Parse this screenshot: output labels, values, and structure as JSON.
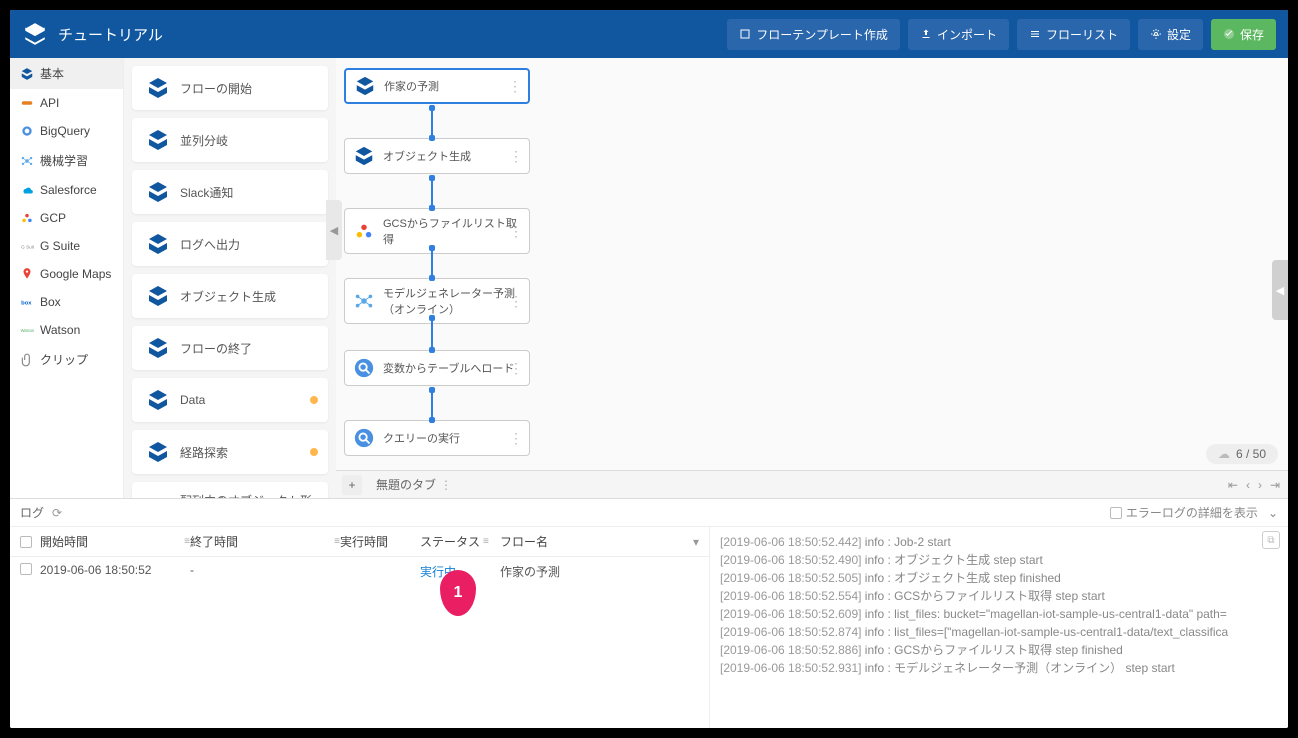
{
  "header": {
    "title": "チュートリアル",
    "buttons": {
      "template": "フローテンプレート作成",
      "import": "インポート",
      "list": "フローリスト",
      "settings": "設定",
      "save": "保存"
    }
  },
  "sidebar": {
    "items": [
      {
        "label": "基本",
        "icon": "cube",
        "color": "#1057a0"
      },
      {
        "label": "API",
        "icon": "api",
        "color": "#e67e22"
      },
      {
        "label": "BigQuery",
        "icon": "bq",
        "color": "#4a90e2"
      },
      {
        "label": "機械学習",
        "icon": "ml",
        "color": "#5aa8e8"
      },
      {
        "label": "Salesforce",
        "icon": "sf",
        "color": "#00a1e0"
      },
      {
        "label": "GCP",
        "icon": "gcp",
        "color": "#ea4335"
      },
      {
        "label": "G Suite",
        "icon": "gsuite",
        "color": "#888"
      },
      {
        "label": "Google Maps",
        "icon": "maps",
        "color": "#ea4335"
      },
      {
        "label": "Box",
        "icon": "box",
        "color": "#0061d5"
      },
      {
        "label": "Watson",
        "icon": "watson",
        "color": "#5aaf6e"
      },
      {
        "label": "クリップ",
        "icon": "clip",
        "color": "#888"
      }
    ]
  },
  "palette": {
    "items": [
      {
        "label": "フローの開始"
      },
      {
        "label": "並列分岐"
      },
      {
        "label": "Slack通知"
      },
      {
        "label": "ログへ出力"
      },
      {
        "label": "オブジェクト生成"
      },
      {
        "label": "フローの終了"
      },
      {
        "label": "Data",
        "dot": "#ffb74d"
      },
      {
        "label": "経路探索",
        "dot": "#ffb74d"
      },
      {
        "label": "配列内のオブジェクト形式",
        "dot": "#81d4fa"
      }
    ]
  },
  "canvas": {
    "nodes": [
      {
        "label": "作家の予測",
        "icon": "cube",
        "selected": true
      },
      {
        "label": "オブジェクト生成",
        "icon": "cube"
      },
      {
        "label": "GCSからファイルリスト取得",
        "icon": "gcp"
      },
      {
        "label": "モデルジェネレーター予測（オンライン）",
        "icon": "ml"
      },
      {
        "label": "変数からテーブルへロード",
        "icon": "bq"
      },
      {
        "label": "クエリーの実行",
        "icon": "bq"
      }
    ],
    "counter": "6 / 50",
    "tab": {
      "label": "無題のタブ"
    }
  },
  "log": {
    "title": "ログ",
    "error_toggle": "エラーログの詳細を表示",
    "columns": {
      "start": "開始時間",
      "end": "終了時間",
      "duration": "実行時間",
      "status": "ステータス",
      "flow": "フロー名"
    },
    "rows": [
      {
        "start": "2019-06-06 18:50:52",
        "end": "-",
        "duration": "",
        "status": "実行中",
        "flow": "作家の予測"
      }
    ],
    "detail": [
      {
        "ts": "[2019-06-06 18:50:52.442]",
        "msg": "info : Job-2 start"
      },
      {
        "ts": "[2019-06-06 18:50:52.490]",
        "msg": "info : オブジェクト生成 step start"
      },
      {
        "ts": "[2019-06-06 18:50:52.505]",
        "msg": "info : オブジェクト生成 step finished"
      },
      {
        "ts": "[2019-06-06 18:50:52.554]",
        "msg": "info : GCSからファイルリスト取得 step start"
      },
      {
        "ts": "[2019-06-06 18:50:52.609]",
        "msg": "info : list_files: bucket=\"magellan-iot-sample-us-central1-data\" path="
      },
      {
        "ts": "[2019-06-06 18:50:52.874]",
        "msg": "info : list_files=[\"magellan-iot-sample-us-central1-data/text_classifica"
      },
      {
        "ts": "[2019-06-06 18:50:52.886]",
        "msg": "info : GCSからファイルリスト取得 step finished"
      },
      {
        "ts": "[2019-06-06 18:50:52.931]",
        "msg": "info : モデルジェネレーター予測（オンライン）  step start"
      }
    ]
  },
  "marker": {
    "label": "1"
  }
}
